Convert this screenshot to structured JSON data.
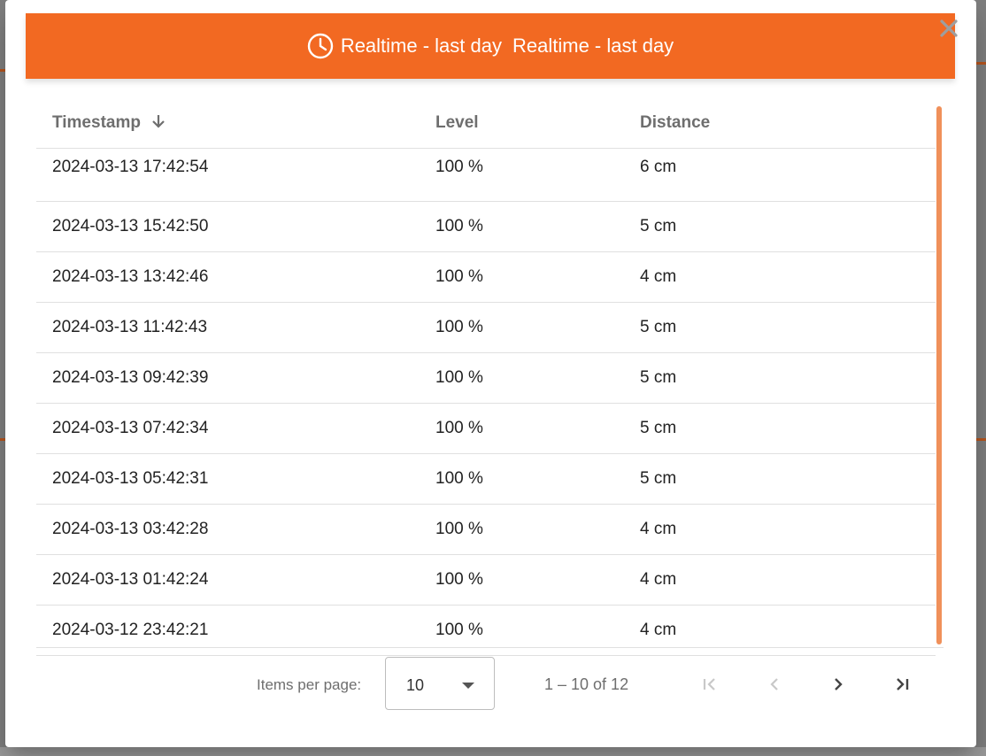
{
  "dialog": {
    "title": "Realtime - last day",
    "subtitle": "Realtime - last day",
    "header_icon": "clock-icon",
    "close_icon": "close-icon",
    "accent_color": "#f26922"
  },
  "table": {
    "columns": [
      "Timestamp",
      "Level",
      "Distance"
    ],
    "sort_icon": "arrow-down-icon",
    "rows": [
      {
        "timestamp": "2024-03-13 17:42:54",
        "level": "100 %",
        "distance": "6 cm"
      },
      {
        "timestamp": "2024-03-13 15:42:50",
        "level": "100 %",
        "distance": "5 cm"
      },
      {
        "timestamp": "2024-03-13 13:42:46",
        "level": "100 %",
        "distance": "4 cm"
      },
      {
        "timestamp": "2024-03-13 11:42:43",
        "level": "100 %",
        "distance": "5 cm"
      },
      {
        "timestamp": "2024-03-13 09:42:39",
        "level": "100 %",
        "distance": "5 cm"
      },
      {
        "timestamp": "2024-03-13 07:42:34",
        "level": "100 %",
        "distance": "5 cm"
      },
      {
        "timestamp": "2024-03-13 05:42:31",
        "level": "100 %",
        "distance": "5 cm"
      },
      {
        "timestamp": "2024-03-13 03:42:28",
        "level": "100 %",
        "distance": "4 cm"
      },
      {
        "timestamp": "2024-03-13 01:42:24",
        "level": "100 %",
        "distance": "4 cm"
      },
      {
        "timestamp": "2024-03-12 23:42:21",
        "level": "100 %",
        "distance": "4 cm"
      }
    ]
  },
  "paginator": {
    "items_per_page_label": "Items per page:",
    "page_size": "10",
    "range_label": "1 – 10 of 12",
    "first_icon": "first-page-icon",
    "prev_icon": "chevron-left-icon",
    "next_icon": "chevron-right-icon",
    "last_icon": "last-page-icon"
  }
}
